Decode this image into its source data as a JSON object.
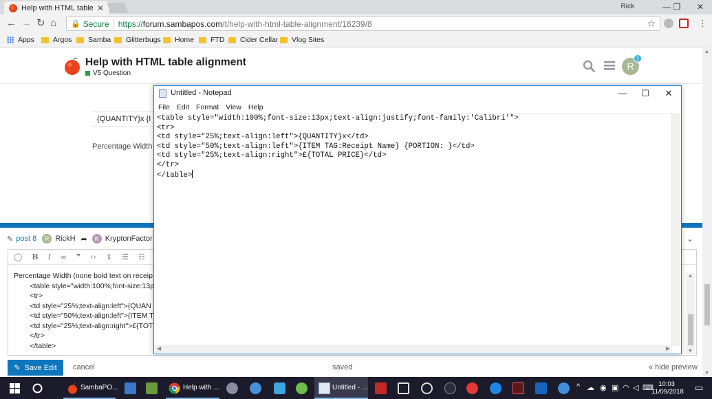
{
  "browser": {
    "tab_title": "Help with HTML table alig",
    "user": "Rick",
    "url": {
      "secure_label": "Secure",
      "scheme": "https://",
      "host": "forum.sambapos.com",
      "path": "/t/help-with-html-table-alignment/18239/8"
    },
    "bookmarks": [
      "Apps",
      "Argos",
      "Samba",
      "Glitterbugs",
      "Home",
      "FTD",
      "Cider Cellar",
      "Vlog Sites"
    ]
  },
  "forum": {
    "topic_title": "Help with HTML table alignment",
    "category": "V5 Question",
    "avatar_letter": "R",
    "notification_count": "1",
    "preview_row_text": "{QUANTITY}x  {I",
    "preview_text": "Percentage Width (",
    "composer": {
      "post_label": "post 8",
      "author": "RickH",
      "author_initial": "R",
      "reply_to": "KryptonFactor",
      "reply_initial": "K",
      "content_lines": [
        "Percentage Width (none bold text on receip",
        "        <table style=\"width:100%;font-size:13p",
        "        <tr>",
        "        <td style=\"25%;text-align:left\">{QUAN",
        "        <td style=\"50%;text-align:left\">{ITEM T",
        "        <td style=\"25%;text-align:right\">£{TOT",
        "        </tr>",
        "        </table>"
      ],
      "save_label": "Save Edit",
      "cancel_label": "cancel",
      "status": "saved",
      "hide_preview_label": "« hide preview"
    }
  },
  "notepad": {
    "title": "Untitled - Notepad",
    "menu": [
      "File",
      "Edit",
      "Format",
      "View",
      "Help"
    ],
    "lines": [
      "<table style=\"width:100%;font-size:13px;text-align:justify;font-family:'Calibri'\">",
      "<tr>",
      "<td style=\"25%;text-align:left\">{QUANTITY}x</td>",
      "<td style=\"50%;text-align:left\">{ITEM TAG:Receipt Name} {PORTION: }</td>",
      "<td style=\"25%;text-align:right\">£{TOTAL PRICE}</td>",
      "</tr>",
      "</table>"
    ]
  },
  "taskbar": {
    "items": [
      "SambaPO...",
      "Help with ...",
      "Untitled - ..."
    ],
    "time": "10:03",
    "date": "11/09/2018"
  },
  "colors": {
    "accent": "#0e76bd",
    "category_green": "#25a244",
    "taskbar": "#1b1b2b"
  }
}
